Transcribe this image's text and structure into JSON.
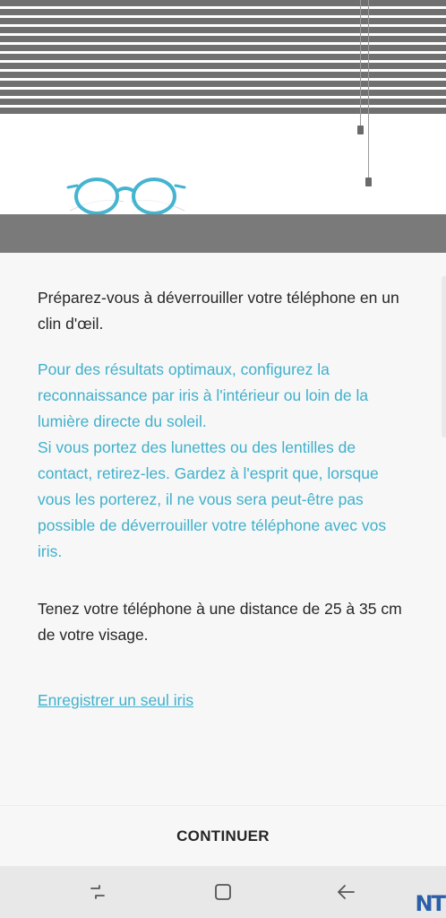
{
  "intro": "Préparez-vous à déverrouiller votre téléphone en un clin d'œil.",
  "tips": [
    "Pour des résultats optimaux, configurez la reconnaissance par iris à l'intérieur ou loin de la lumière directe du soleil.",
    "Si vous portez des lunettes ou des lentilles de contact, retirez-les. Gardez à l'esprit que, lorsque vous les porterez, il ne vous sera peut-être pas possible de déverrouiller votre téléphone avec vos iris."
  ],
  "distance_note": "Tenez votre téléphone à une distance de 25 à 35 cm de votre visage.",
  "single_iris_link": "Enregistrer un seul iris",
  "continue_label": "CONTINUER",
  "watermark": "NT",
  "colors": {
    "accent": "#3fb0cc",
    "text": "#262626",
    "blinds": "#707070",
    "sill": "#7a7a7a",
    "background": "#f7f7f7"
  },
  "icons": {
    "illustration": "glasses-icon",
    "nav_recent": "recent-apps-icon",
    "nav_home": "home-icon",
    "nav_back": "back-arrow-icon"
  }
}
